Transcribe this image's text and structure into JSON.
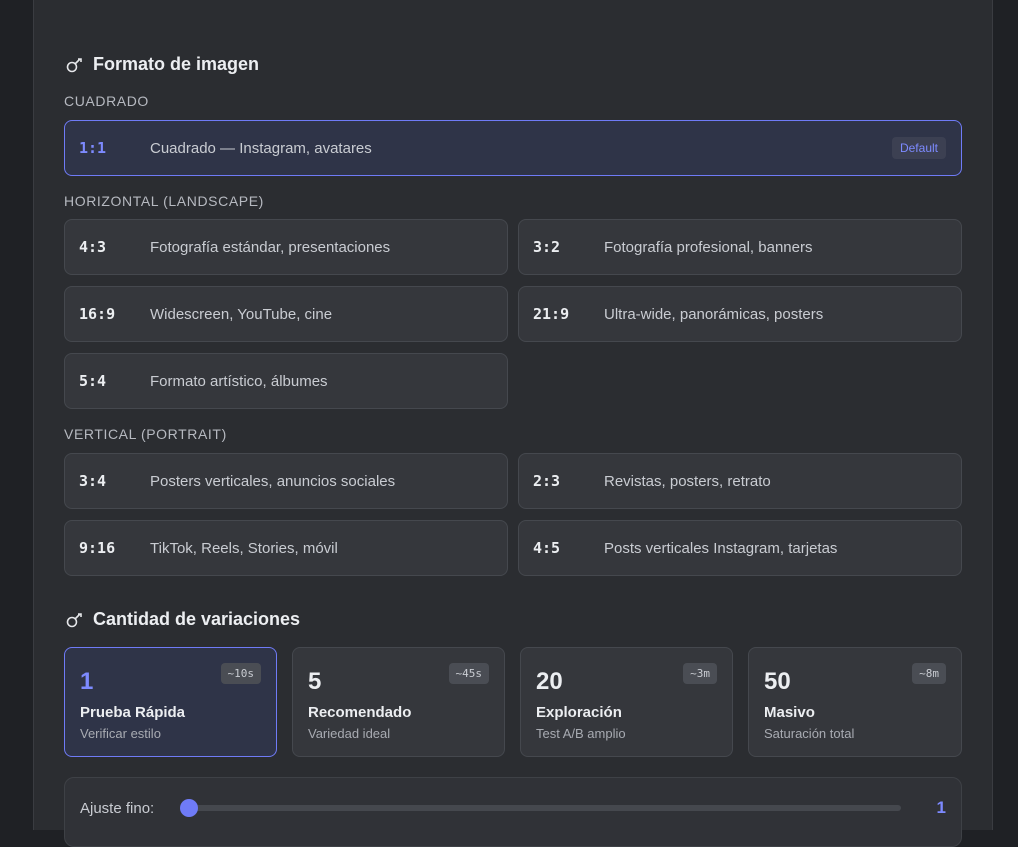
{
  "format_section": {
    "title": "Formato de imagen",
    "icon": "palette-icon",
    "groups": [
      {
        "label": "CUADRADO",
        "items": [
          {
            "ratio": "1:1",
            "desc": "Cuadrado — Instagram, avatares",
            "badge": "Default",
            "selected": true
          }
        ]
      },
      {
        "label": "HORIZONTAL (LANDSCAPE)",
        "items": [
          {
            "ratio": "4:3",
            "desc": "Fotografía estándar, presentaciones"
          },
          {
            "ratio": "3:2",
            "desc": "Fotografía profesional, banners"
          },
          {
            "ratio": "16:9",
            "desc": "Widescreen, YouTube, cine"
          },
          {
            "ratio": "21:9",
            "desc": "Ultra-wide, panorámicas, posters"
          },
          {
            "ratio": "5:4",
            "desc": "Formato artístico, álbumes"
          }
        ]
      },
      {
        "label": "VERTICAL (PORTRAIT)",
        "items": [
          {
            "ratio": "3:4",
            "desc": "Posters verticales, anuncios sociales"
          },
          {
            "ratio": "2:3",
            "desc": "Revistas, posters, retrato"
          },
          {
            "ratio": "9:16",
            "desc": "TikTok, Reels, Stories, móvil"
          },
          {
            "ratio": "4:5",
            "desc": "Posts verticales Instagram, tarjetas"
          }
        ]
      }
    ]
  },
  "variations_section": {
    "title": "Cantidad de variaciones",
    "icon": "palette-icon",
    "options": [
      {
        "count": "1",
        "title": "Prueba Rápida",
        "subtitle": "Verificar estilo",
        "time": "~10s",
        "selected": true
      },
      {
        "count": "5",
        "title": "Recomendado",
        "subtitle": "Variedad ideal",
        "time": "~45s"
      },
      {
        "count": "20",
        "title": "Exploración",
        "subtitle": "Test A/B amplio",
        "time": "~3m"
      },
      {
        "count": "50",
        "title": "Masivo",
        "subtitle": "Saturación total",
        "time": "~8m"
      }
    ],
    "fine_tune": {
      "label": "Ajuste fino:",
      "value": "1",
      "fraction": 0
    }
  },
  "colors": {
    "accent": "#6f7bf7",
    "panel": "#2b2d31",
    "card": "#35373c"
  }
}
